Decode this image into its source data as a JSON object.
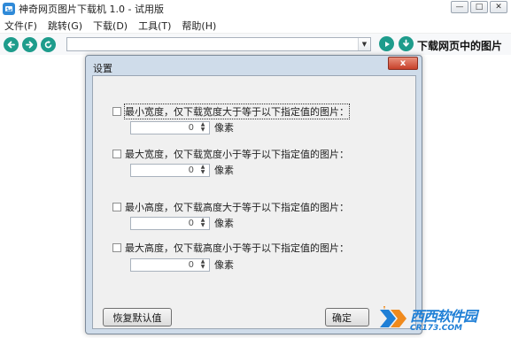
{
  "window": {
    "title": "神奇网页图片下载机 1.0 - 试用版",
    "controls": {
      "minimize": "—",
      "maximize": "□",
      "close": "✕"
    }
  },
  "menu": [
    "文件(F)",
    "跳转(G)",
    "下载(D)",
    "工具(T)",
    "帮助(H)"
  ],
  "toolbar": {
    "url_value": "",
    "download_label": "下载网页中的图片",
    "icons": [
      "back-icon",
      "forward-icon",
      "refresh-icon",
      "dropdown-arrow-icon",
      "play-icon",
      "download-icon"
    ]
  },
  "dialog": {
    "title": "设置",
    "close_glyph": "x",
    "options": [
      {
        "label": "最小宽度，仅下载宽度大于等于以下指定值的图片：",
        "checked": false,
        "value": "0",
        "unit": "像素"
      },
      {
        "label": "最大宽度，仅下载宽度小于等于以下指定值的图片：",
        "checked": false,
        "value": "0",
        "unit": "像素"
      },
      {
        "label": "最小高度，仅下载高度大于等于以下指定值的图片：",
        "checked": false,
        "value": "0",
        "unit": "像素"
      },
      {
        "label": "最大高度，仅下载高度小于等于以下指定值的图片：",
        "checked": false,
        "value": "0",
        "unit": "像素"
      }
    ],
    "reset_label": "恢复默认值",
    "ok_label": "确定"
  },
  "watermark": {
    "cn": "西西软件园",
    "en": "CR173.COM"
  },
  "colors": {
    "accent_teal": "#1e9c8c",
    "dialog_frame": "#cfdcea",
    "close_red": "#c7412a",
    "watermark_blue": "#1f7fd6"
  }
}
